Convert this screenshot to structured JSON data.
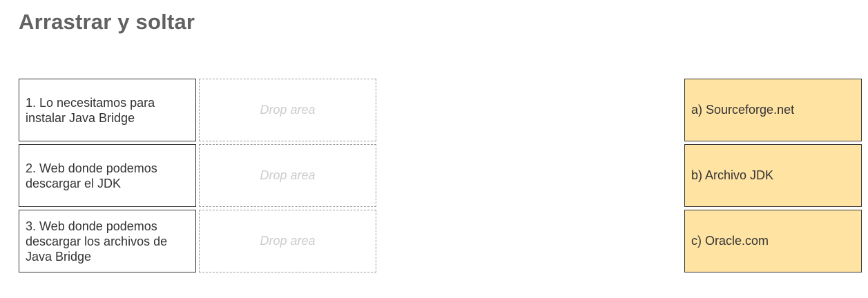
{
  "title": "Arrastrar y soltar",
  "questions": [
    {
      "text": "1. Lo necesitamos para instalar Java Bridge"
    },
    {
      "text": "2. Web donde podemos descargar el JDK"
    },
    {
      "text": "3. Web donde podemos descargar los archivos de Java Bridge"
    }
  ],
  "drop_area_label": "Drop area",
  "answers": [
    {
      "text": "a) Sourceforge.net"
    },
    {
      "text": "b) Archivo JDK"
    },
    {
      "text": "c) Oracle.com"
    }
  ],
  "colors": {
    "answer_bg": "#ffe3a3",
    "title": "#616161",
    "drop_text": "#cccccc"
  }
}
